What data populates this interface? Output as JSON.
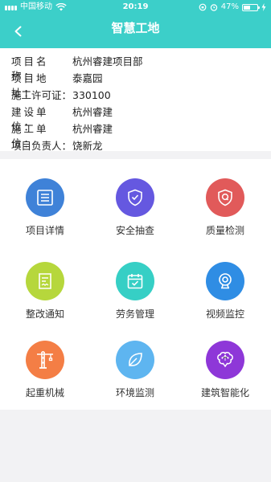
{
  "status_bar": {
    "carrier": "中国移动",
    "time": "20:19",
    "battery": "47%",
    "battery_level": 0.47
  },
  "nav": {
    "title": "智慧工地"
  },
  "project": [
    {
      "label": "项目名称：",
      "value": "杭州睿建项目部"
    },
    {
      "label": "项目地址：",
      "value": "泰嘉园"
    },
    {
      "label": "施工许可证：",
      "value": "330100"
    },
    {
      "label": "建设单位：",
      "value": "杭州睿建"
    },
    {
      "label": "施工单位：",
      "value": "杭州睿建"
    },
    {
      "label": "项目负责人：",
      "value": "饶新龙"
    }
  ],
  "modules": [
    {
      "label": "项目详情",
      "icon": "list-icon",
      "color": "#3f82d8"
    },
    {
      "label": "安全抽查",
      "icon": "shield-check-icon",
      "color": "#6558e0"
    },
    {
      "label": "质量检测",
      "icon": "quality-q-icon",
      "color": "#e15a5a"
    },
    {
      "label": "整改通知",
      "icon": "notice-doc-icon",
      "color": "#b6d73c"
    },
    {
      "label": "劳务管理",
      "icon": "calendar-check-icon",
      "color": "#36cfc5"
    },
    {
      "label": "视频监控",
      "icon": "webcam-icon",
      "color": "#2f8de4"
    },
    {
      "label": "起重机械",
      "icon": "tower-crane-icon",
      "color": "#f47e45"
    },
    {
      "label": "环境监测",
      "icon": "leaf-icon",
      "color": "#5eb5f0"
    },
    {
      "label": "建筑智能化",
      "icon": "brain-icon",
      "color": "#8e37d8"
    }
  ]
}
